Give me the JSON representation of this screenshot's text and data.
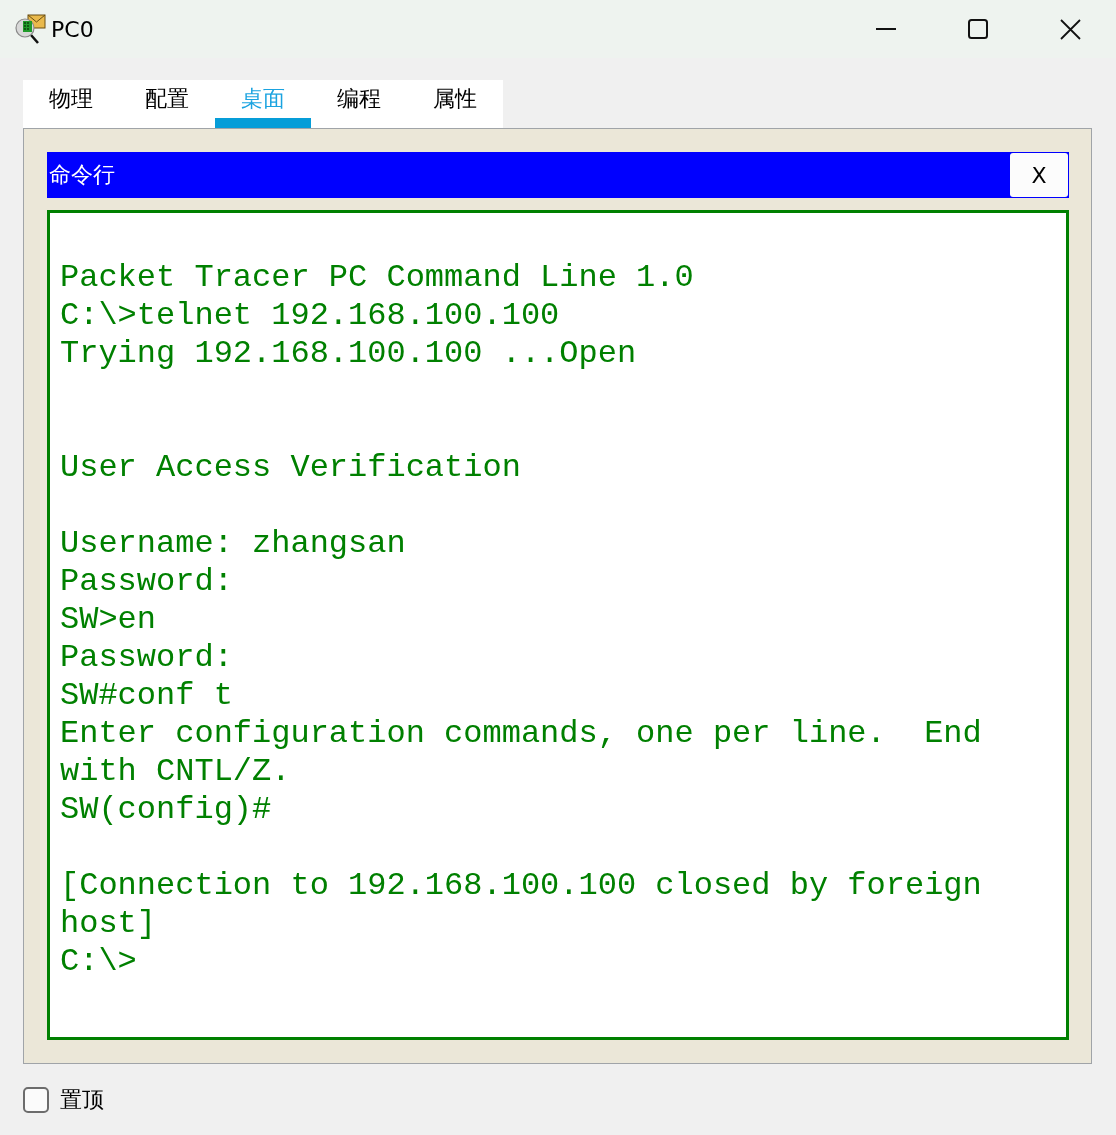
{
  "window": {
    "title": "PC0"
  },
  "tabs": [
    {
      "label": "物理",
      "selected": false
    },
    {
      "label": "配置",
      "selected": false
    },
    {
      "label": "桌面",
      "selected": true
    },
    {
      "label": "编程",
      "selected": false
    },
    {
      "label": "属性",
      "selected": false
    }
  ],
  "panel": {
    "title": "命令行",
    "close_label": "X"
  },
  "terminal": {
    "lines": [
      {
        "kind": "blank"
      },
      {
        "kind": "text",
        "text": "Packet Tracer PC Command Line 1.0"
      },
      {
        "kind": "text",
        "text": "C:\\>telnet 192.168.100.100"
      },
      {
        "kind": "text",
        "text": "Trying 192.168.100.100 ...Open"
      },
      {
        "kind": "blank"
      },
      {
        "kind": "blank"
      },
      {
        "kind": "text",
        "text": "User Access Verification"
      },
      {
        "kind": "blank"
      },
      {
        "kind": "text",
        "text": "Username: zhangsan"
      },
      {
        "kind": "text",
        "text": "Password:"
      },
      {
        "kind": "text",
        "text": "SW>en"
      },
      {
        "kind": "text",
        "text": "Password:"
      },
      {
        "kind": "text",
        "text": "SW#conf t"
      },
      {
        "kind": "text",
        "text": "Enter configuration commands, one per line.  End"
      },
      {
        "kind": "text",
        "text": "with CNTL/Z."
      },
      {
        "kind": "text",
        "text": "SW(config)#"
      },
      {
        "kind": "blank"
      },
      {
        "kind": "text",
        "text": "[Connection to 192.168.100.100 closed by foreign"
      },
      {
        "kind": "text",
        "text": "host]"
      },
      {
        "kind": "text",
        "text": "C:\\>"
      }
    ]
  },
  "always_on_top": {
    "label": "置顶",
    "checked": false
  }
}
